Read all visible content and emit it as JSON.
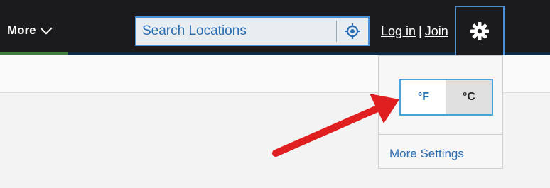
{
  "nav": {
    "more_label": "More",
    "search_placeholder": "Search Locations",
    "login_label": "Log in",
    "separator": "|",
    "join_label": "Join"
  },
  "settings": {
    "fahrenheit_label": "°F",
    "celsius_label": "°C",
    "more_settings_label": "More Settings"
  },
  "colors": {
    "nav_bg": "#1b1b1d",
    "accent_blue": "#4a90d9",
    "link_blue": "#2b6cb0",
    "annotation_red": "#e02020"
  },
  "icons": {
    "locate": "locate-icon",
    "gear": "gear-icon",
    "chevron": "chevron-down-icon",
    "arrow": "annotation-arrow"
  }
}
